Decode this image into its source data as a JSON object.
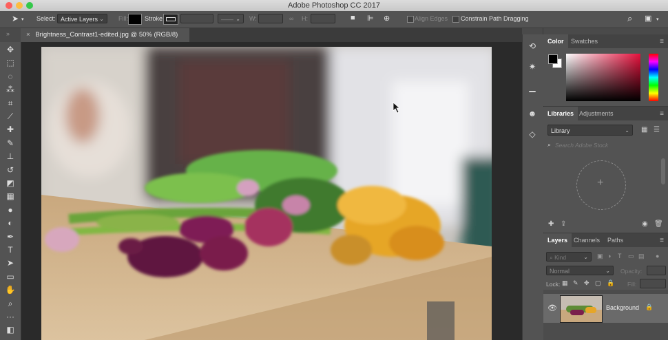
{
  "app": {
    "title": "Adobe Photoshop CC 2017"
  },
  "colors": {
    "close": "#fc605c",
    "minimize": "#fdbc40",
    "zoom": "#34c84a",
    "panel_bg": "#535353",
    "canvas_bg": "#2a2a2a"
  },
  "options_bar": {
    "select_label": "Select:",
    "select_value": "Active Layers",
    "fill_label": "Fill:",
    "stroke_label": "Stroke:",
    "w_label": "W:",
    "h_label": "H:",
    "align_edges_label": "Align Edges",
    "constrain_label": "Constrain Path Dragging"
  },
  "document": {
    "tab_title": "Brightness_Contrast1-edited.jpg @ 50% (RGB/8)",
    "close_glyph": "×"
  },
  "tools": [
    {
      "name": "move-tool",
      "glyph": "✥"
    },
    {
      "name": "marquee-tool",
      "glyph": "⬚"
    },
    {
      "name": "lasso-tool",
      "glyph": "◌"
    },
    {
      "name": "quick-select-tool",
      "glyph": "⁂"
    },
    {
      "name": "crop-tool",
      "glyph": "⌗"
    },
    {
      "name": "eyedropper-tool",
      "glyph": "⟋"
    },
    {
      "name": "healing-tool",
      "glyph": "✚"
    },
    {
      "name": "brush-tool",
      "glyph": "✎"
    },
    {
      "name": "clone-stamp-tool",
      "glyph": "⊥"
    },
    {
      "name": "history-brush-tool",
      "glyph": "↺"
    },
    {
      "name": "eraser-tool",
      "glyph": "◩"
    },
    {
      "name": "gradient-tool",
      "glyph": "▦"
    },
    {
      "name": "blur-tool",
      "glyph": "●"
    },
    {
      "name": "dodge-tool",
      "glyph": "◐"
    },
    {
      "name": "pen-tool",
      "glyph": "✒"
    },
    {
      "name": "type-tool",
      "glyph": "T"
    },
    {
      "name": "path-select-tool",
      "glyph": "➤"
    },
    {
      "name": "rectangle-tool",
      "glyph": "▭"
    },
    {
      "name": "hand-tool",
      "glyph": "✋"
    },
    {
      "name": "zoom-tool",
      "glyph": "⌕"
    },
    {
      "name": "more-tools",
      "glyph": "···"
    },
    {
      "name": "color-swatch",
      "glyph": "◧"
    }
  ],
  "icon_strip": [
    {
      "name": "history-icon",
      "glyph": "⟲"
    },
    {
      "name": "adjust-icon",
      "glyph": "✷"
    },
    {
      "name": "levels-icon",
      "glyph": "▁"
    },
    {
      "name": "people-icon",
      "glyph": "☻"
    },
    {
      "name": "paths-icon",
      "glyph": "◇"
    }
  ],
  "color_panel": {
    "tabs": [
      "Color",
      "Swatches"
    ]
  },
  "libraries_panel": {
    "tabs": [
      "Libraries",
      "Adjustments"
    ],
    "library_select": "Library",
    "search_placeholder": "Search Adobe Stock"
  },
  "layers_panel": {
    "tabs": [
      "Layers",
      "Channels",
      "Paths"
    ],
    "kind_label": "Kind",
    "blend_mode": "Normal",
    "opacity_label": "Opacity:",
    "lock_label": "Lock:",
    "fill_label": "Fill:",
    "layers": [
      {
        "name": "Background",
        "visible": true,
        "locked": true
      }
    ]
  }
}
